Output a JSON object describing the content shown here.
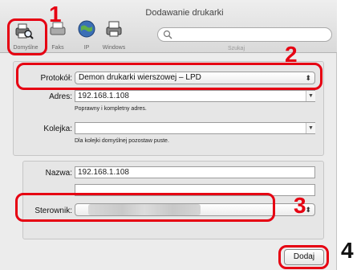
{
  "window": {
    "title": "Dodawanie drukarki"
  },
  "toolbar": {
    "default_label": "Domyślne",
    "fax_label": "Faks",
    "ip_label": "IP",
    "windows_label": "Windows",
    "search_label": "Szukaj",
    "search_value": ""
  },
  "form": {
    "protocol_label": "Protokół:",
    "protocol_value": "Demon drukarki wierszowej – LPD",
    "address_label": "Adres:",
    "address_value": "192.168.1.108",
    "address_hint": "Poprawny i kompletny adres.",
    "queue_label": "Kolejka:",
    "queue_value": "",
    "queue_hint": "Dla kolejki domyślnej pozostaw puste.",
    "name_label": "Nazwa:",
    "name_value": "192.168.1.108",
    "location_value": "",
    "driver_label": "Sterownik:"
  },
  "buttons": {
    "add_label": "Dodaj"
  },
  "callouts": [
    "1",
    "2",
    "3",
    "4"
  ],
  "colors": {
    "callout": "#e60012"
  }
}
